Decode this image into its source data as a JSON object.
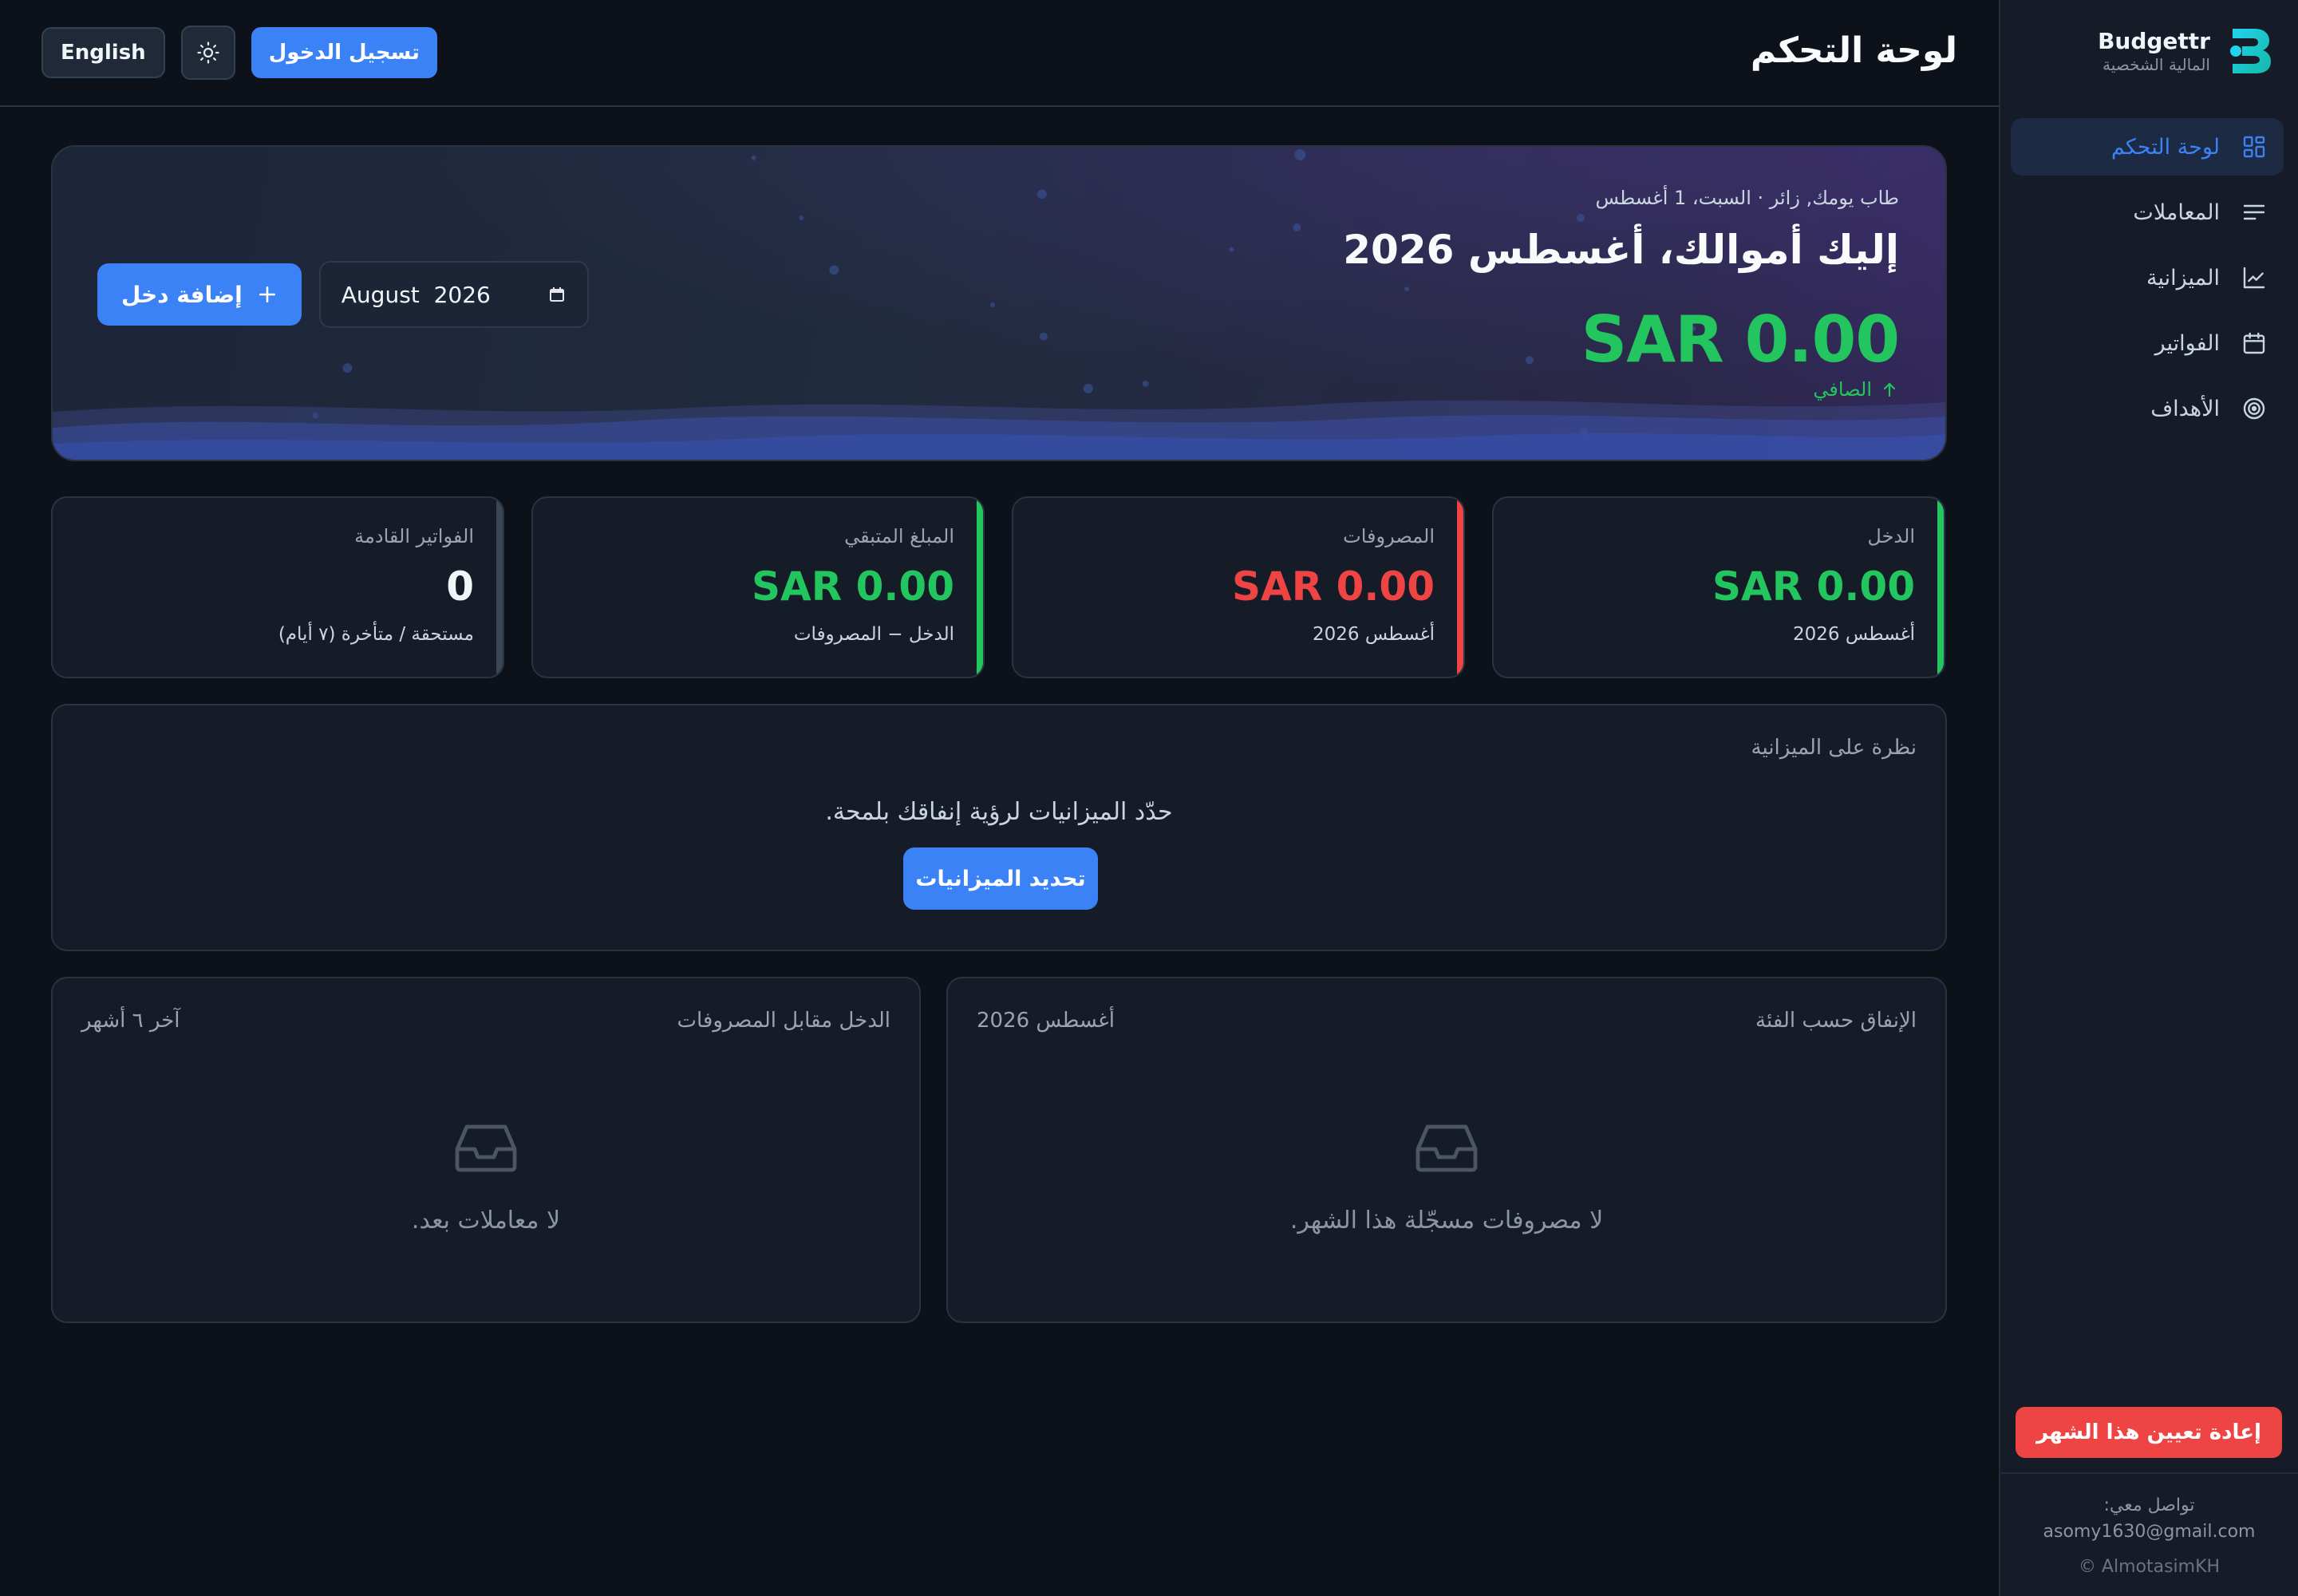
{
  "brand": {
    "name": "Budgettr",
    "tagline": "المالية الشخصية"
  },
  "sidebar": {
    "items": [
      {
        "label": "لوحة التحكم",
        "icon": "dashboard-grid-icon",
        "active": true
      },
      {
        "label": "المعاملات",
        "icon": "list-lines-icon",
        "active": false
      },
      {
        "label": "الميزانية",
        "icon": "line-chart-icon",
        "active": false
      },
      {
        "label": "الفواتير",
        "icon": "calendar-icon",
        "active": false
      },
      {
        "label": "الأهداف",
        "icon": "target-icon",
        "active": false
      }
    ],
    "reset_label": "إعادة تعيين هذا الشهر",
    "footer": {
      "contact_label": "تواصل معي:",
      "email": "asomy1630@gmail.com",
      "copyright": "© AlmotasimKH"
    }
  },
  "header": {
    "title": "لوحة التحكم",
    "login_label": "تسجيل الدخول",
    "theme_icon": "sun-icon",
    "language_label": "English"
  },
  "hero": {
    "greeting": "طاب يومك, زائر · السبت، 1 أغسطس",
    "title": "إليك أموالك، أغسطس 2026",
    "net_amount": "SAR 0.00",
    "net_label": "الصافي",
    "add_income_label": "إضافة دخل",
    "month_value": "August  2026"
  },
  "stats": [
    {
      "label": "الدخل",
      "value": "SAR 0.00",
      "sub": "أغسطس 2026",
      "color": "#22c55e"
    },
    {
      "label": "المصروفات",
      "value": "SAR 0.00",
      "sub": "أغسطس 2026",
      "color": "#ef4444"
    },
    {
      "label": "المبلغ المتبقي",
      "value": "SAR 0.00",
      "sub": "الدخل − المصروفات",
      "color": "#22c55e"
    },
    {
      "label": "الفواتير القادمة",
      "value": "0",
      "sub": "مستحقة / متأخرة (٧ أيام)",
      "color": "#f1f5f9"
    }
  ],
  "budget_overview": {
    "title": "نظرة على الميزانية",
    "message": "حدّد الميزانيات لرؤية إنفاقك بلمحة.",
    "button_label": "تحديد الميزانيات"
  },
  "panels": {
    "spending_by_category": {
      "title": "الإنفاق حسب الفئة",
      "meta": "أغسطس 2026",
      "empty": "لا مصروفات مسجّلة هذا الشهر."
    },
    "income_vs_expenses": {
      "title": "الدخل مقابل المصروفات",
      "meta": "آخر ٦ أشهر",
      "empty": "لا معاملات بعد."
    }
  },
  "colors": {
    "accent": "#3b82f6",
    "positive": "#22c55e",
    "negative": "#ef4444",
    "background": "#0c111a",
    "card": "#151c27"
  }
}
